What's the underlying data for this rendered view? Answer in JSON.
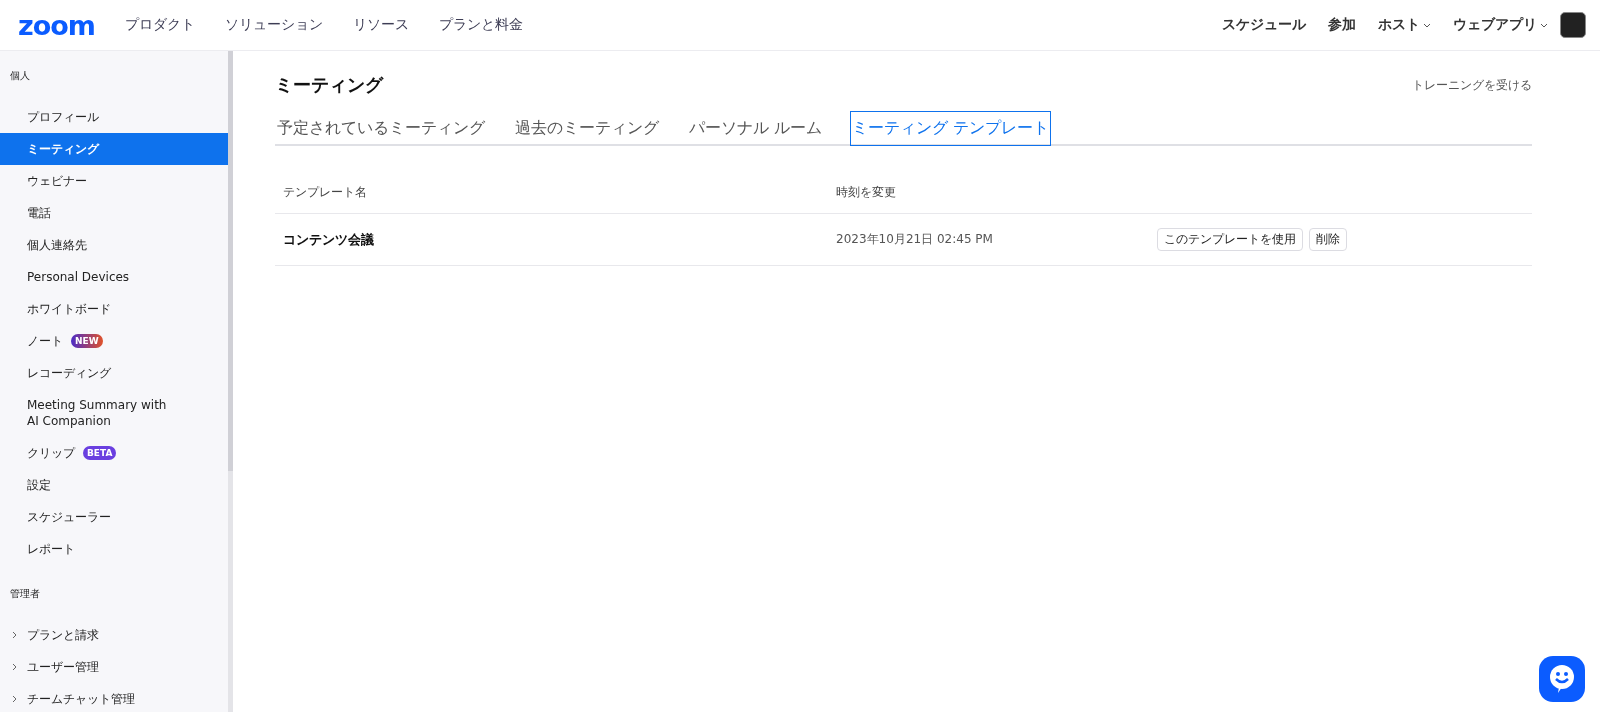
{
  "header": {
    "logo": "zoom",
    "nav": [
      "プロダクト",
      "ソリューション",
      "リソース",
      "プランと料金"
    ],
    "actions": [
      {
        "label": "スケジュール",
        "has_menu": false
      },
      {
        "label": "参加",
        "has_menu": false
      },
      {
        "label": "ホスト",
        "has_menu": true
      },
      {
        "label": "ウェブアプリ",
        "has_menu": true
      }
    ]
  },
  "sidebar": {
    "sections": [
      {
        "title": "個人",
        "items": [
          {
            "label": "プロフィール",
            "selected": false
          },
          {
            "label": "ミーティング",
            "selected": true
          },
          {
            "label": "ウェビナー",
            "selected": false
          },
          {
            "label": "電話",
            "selected": false
          },
          {
            "label": "個人連絡先",
            "selected": false
          },
          {
            "label": "Personal Devices",
            "selected": false
          },
          {
            "label": "ホワイトボード",
            "selected": false
          },
          {
            "label": "ノート",
            "selected": false,
            "badge": {
              "text": "NEW",
              "kind": "new"
            }
          },
          {
            "label": "レコーディング",
            "selected": false
          },
          {
            "label": "Meeting Summary with AI Companion",
            "selected": false
          },
          {
            "label": "クリップ",
            "selected": false,
            "badge": {
              "text": "BETA",
              "kind": "beta"
            }
          },
          {
            "label": "設定",
            "selected": false
          },
          {
            "label": "スケジューラー",
            "selected": false
          },
          {
            "label": "レポート",
            "selected": false
          }
        ]
      },
      {
        "title": "管理者",
        "items": [
          {
            "label": "プランと請求",
            "selected": false,
            "expanded": false
          },
          {
            "label": "ユーザー管理",
            "selected": false,
            "expanded": false
          },
          {
            "label": "チームチャット管理",
            "selected": false,
            "expanded": false
          }
        ]
      }
    ]
  },
  "main": {
    "title": "ミーティング",
    "training_link": "トレーニングを受ける",
    "tabs": [
      {
        "label": "予定されているミーティング",
        "selected": false
      },
      {
        "label": "過去のミーティング",
        "selected": false
      },
      {
        "label": "パーソナル ルーム",
        "selected": false
      },
      {
        "label": "ミーティング テンプレート",
        "selected": true
      }
    ],
    "table": {
      "columns": [
        "テンプレート名",
        "時刻を変更"
      ],
      "rows": [
        {
          "name": "コンテンツ会議",
          "modified": "2023年10月21日 02:45 PM",
          "buttons": [
            "このテンプレートを使用",
            "削除"
          ]
        }
      ]
    }
  }
}
